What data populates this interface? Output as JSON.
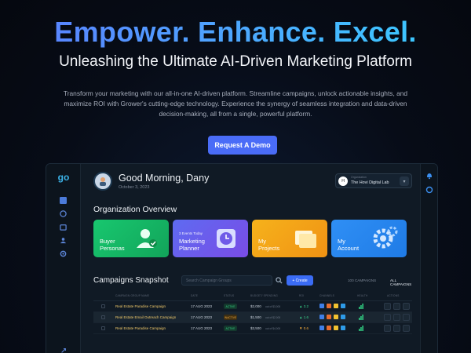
{
  "hero": {
    "title": "Empower. Enhance. Excel.",
    "subtitle": "Unleashing the Ultimate AI-Driven Marketing Platform",
    "description": "Transform your marketing with our all-in-one AI-driven platform. Streamline campaigns, unlock actionable insights, and maximize ROI with Grower's cutting-edge technology. Experience the synergy of seamless integration and data-driven decision-making, all from a single, powerful platform.",
    "cta_label": "Request A Demo"
  },
  "app": {
    "logo_text": "go",
    "greeting": "Good Morning, Dany",
    "date": "October 3, 2023",
    "org": {
      "small_label": "Organization",
      "name": "The Hovi Digital Lab",
      "badge": "H"
    },
    "overview_title": "Organization Overview",
    "cards": [
      {
        "label": "Buyer\nPersonas",
        "small": ""
      },
      {
        "label": "Marketing\nPlanner",
        "small": "3 Events Today"
      },
      {
        "label": "My\nProjects",
        "small": ""
      },
      {
        "label": "My\nAccount",
        "small": ""
      }
    ],
    "campaigns": {
      "title": "Campaigns Snapshot",
      "search_placeholder": "Search Campaign Groups",
      "create_label": "+ Create",
      "tab_mine": "100 CAMPAIGNS",
      "tab_all": "ALL CAMPAIGNS",
      "columns": [
        "CAMPAIGN GROUP NAME",
        "DATE",
        "STATUS",
        "BUDGET/ SPENDING",
        "ROI",
        "CHANNELS",
        "HEALTH",
        "ACTIONS"
      ],
      "rows": [
        {
          "name": "Real Estate Paradise Campaign",
          "date": "17 AUG 2023",
          "status": "ACTIVE",
          "budget": "$2,000",
          "budget_sub": "out of $3,000",
          "roi": "▲ 3.2"
        },
        {
          "name": "Real Estate Email Outreach Campaign",
          "date": "17 AUG 2023",
          "status": "INACTIVE",
          "budget": "$1,500",
          "budget_sub": "out of $2,000",
          "roi": "▲ 1.6"
        },
        {
          "name": "Real Estate Paradise Campaign",
          "date": "17 AUG 2023",
          "status": "ACTIVE",
          "budget": "$3,500",
          "budget_sub": "out of $4,000",
          "roi": "▼ 0.6"
        }
      ]
    }
  },
  "colors": {
    "accent": "#4a6cf7",
    "active": "#32d486",
    "inactive": "#f2a93a"
  }
}
